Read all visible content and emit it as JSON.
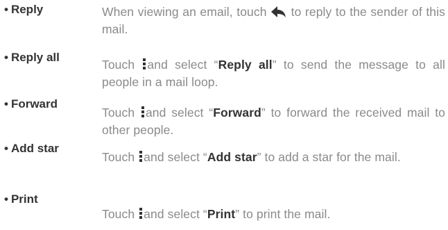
{
  "items": [
    {
      "term": "Reply",
      "before": "When viewing an email, touch",
      "icon": "reply-arrow-icon",
      "after": "to reply to the sender of this mail."
    },
    {
      "term": "Reply all",
      "before": "Touch",
      "icon": "more-vertical-icon",
      "mid": "and select “",
      "bold": "Reply all",
      "after": "” to send the message to all people in a mail loop."
    },
    {
      "term": "Forward",
      "before": "Touch",
      "icon": "more-vertical-icon",
      "mid": "and select “",
      "bold": "Forward",
      "after": "” to forward the received mail to other people."
    },
    {
      "term": "Add star",
      "before": "Touch",
      "icon": "more-vertical-icon",
      "mid": "and select “",
      "bold": "Add star",
      "after": "” to add a star for the mail."
    },
    {
      "term": "Print",
      "before": "Touch",
      "icon": "more-vertical-icon",
      "mid": "and select “",
      "bold": "Print",
      "after": "” to print the mail."
    }
  ],
  "bullet": "•",
  "colors": {
    "term": "#333333",
    "description": "#8a8a8a",
    "bold": "#333333",
    "icon": "#333333"
  }
}
